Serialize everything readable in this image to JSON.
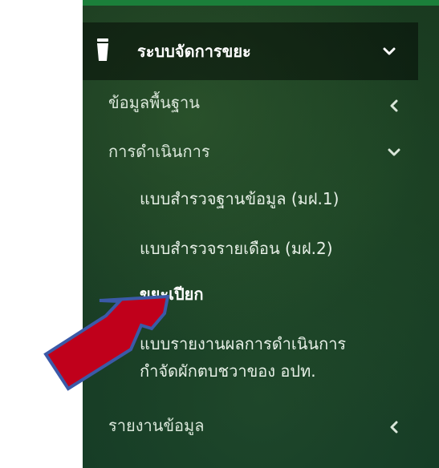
{
  "menu": {
    "section_title": "ระบบจัดการขยะ",
    "items": [
      {
        "label": "ข้อมูลพื้นฐาน"
      },
      {
        "label": "การดำเนินการ"
      },
      {
        "label": "รายงานข้อมูล"
      }
    ],
    "subitems": [
      {
        "label": "แบบสำรวจฐานข้อมูล (มฝ.1)"
      },
      {
        "label": "แบบสำรวจรายเดือน (มฝ.2)"
      },
      {
        "label": "ขยะเปียก"
      },
      {
        "label_line1": "แบบรายงานผลการดำเนินการ",
        "label_line2": "กำจัดผักตบชวาของ อปท."
      }
    ]
  },
  "icons": {
    "section": "trash-icon",
    "expanded": "chevron-down-icon",
    "collapsed": "chevron-left-icon",
    "pointer": "red-arrow-annotation"
  },
  "colors": {
    "sidebar_bg": "#183a22",
    "header_bg": "#0f1f14",
    "text": "#d9e6d9",
    "active_text": "#ffffff",
    "arrow": "#c0001b",
    "arrow_outline": "#3b5aa8"
  }
}
